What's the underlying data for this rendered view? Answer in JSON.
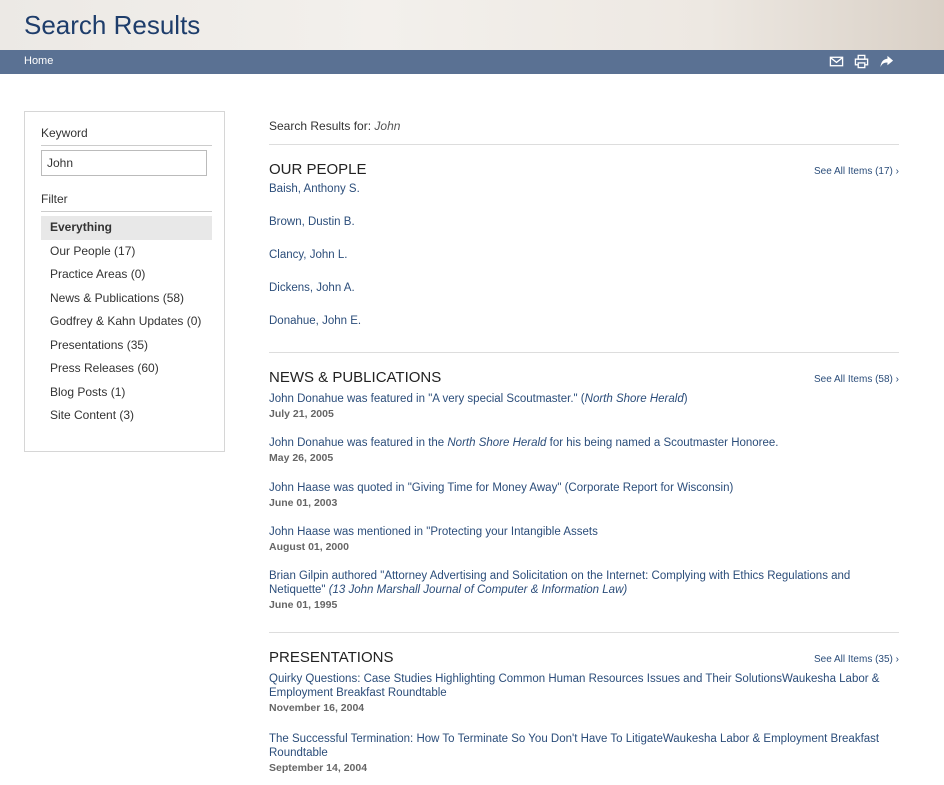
{
  "header": {
    "title": "Search Results"
  },
  "nav": {
    "home": "Home",
    "icons": [
      "email-icon",
      "print-icon",
      "share-icon"
    ]
  },
  "sidebar": {
    "keyword_label": "Keyword",
    "keyword_value": "John",
    "filter_label": "Filter",
    "filters": [
      {
        "label": "Everything"
      },
      {
        "label": "Our People (17)"
      },
      {
        "label": "Practice Areas (0)"
      },
      {
        "label": "News & Publications (58)"
      },
      {
        "label": "Godfrey & Kahn Updates (0)"
      },
      {
        "label": "Presentations (35)"
      },
      {
        "label": "Press Releases (60)"
      },
      {
        "label": "Blog Posts (1)"
      },
      {
        "label": "Site Content (3)"
      }
    ]
  },
  "results": {
    "prefix": "Search Results for:",
    "term": "John",
    "people": {
      "title": "OUR PEOPLE",
      "see_all": "See All Items (17) ›",
      "items": [
        "Baish, Anthony S.",
        "Brown, Dustin B.",
        "Clancy, John L.",
        "Dickens, John A.",
        "Donahue, John E."
      ]
    },
    "news": {
      "title": "NEWS & PUBLICATIONS",
      "see_all": "See All Items (58) ›",
      "items": [
        {
          "a": "John Donahue was featured in \"A very special Scoutmaster.\" (",
          "em": "North Shore Herald",
          "b": ")",
          "date": "July 21, 2005"
        },
        {
          "a": "John Donahue was featured in the ",
          "em": "North Shore Herald",
          "b": " for his being named a Scoutmaster Honoree.",
          "date": "May 26, 2005"
        },
        {
          "a": "John Haase was quoted in \"Giving Time for Money Away\" (Corporate Report for Wisconsin)",
          "em": "",
          "b": "",
          "date": "June 01, 2003"
        },
        {
          "a": "John Haase was mentioned in \"Protecting your Intangible Assets",
          "em": "",
          "b": "",
          "date": "August 01, 2000"
        },
        {
          "a": "Brian Gilpin authored \"Attorney Advertising and Solicitation on the Internet: Complying with Ethics Regulations and Netiquette\" ",
          "em": "(13 John Marshall Journal of Computer & Information Law)",
          "b": "",
          "date": "June 01, 1995"
        }
      ]
    },
    "presentations": {
      "title": "PRESENTATIONS",
      "see_all": "See All Items (35) ›",
      "items": [
        {
          "text": "Quirky Questions: Case Studies Highlighting Common Human Resources Issues and Their SolutionsWaukesha Labor & Employment Breakfast Roundtable",
          "date": "November 16, 2004"
        },
        {
          "text": "The Successful Termination: How To Terminate So You Don't Have To LitigateWaukesha Labor & Employment Breakfast Roundtable",
          "date": "September 14, 2004"
        }
      ]
    }
  }
}
